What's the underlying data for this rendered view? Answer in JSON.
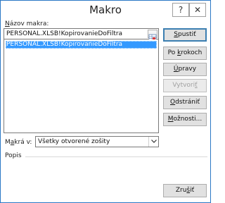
{
  "window": {
    "title": "Makro",
    "help_label": "?",
    "close_label": "✕"
  },
  "form": {
    "macro_name_label": "Názov makra:",
    "macro_name_access_key": "N",
    "macro_name_rest": "ázov makra:",
    "macro_name_value": "PERSONAL.XLSB!KopirovanieDoFiltra",
    "macro_list": [
      "PERSONAL.XLSB!KopirovanieDoFiltra"
    ],
    "macros_in_label": "Makrá v:",
    "macros_in_access_key": "a",
    "macros_in_prefix": "M",
    "macros_in_rest": "krá v:",
    "macros_in_value": "Všetky otvorené zošity",
    "description_label": "Popis"
  },
  "buttons": {
    "run": {
      "pre": "",
      "key": "S",
      "post": "pustiť"
    },
    "step_into": {
      "pre": "Po ",
      "key": "k",
      "post": "rokoch"
    },
    "edit": {
      "pre": "",
      "key": "Ú",
      "post": "pravy"
    },
    "create": {
      "pre": "Vytvori",
      "key": "ť",
      "post": ""
    },
    "delete": {
      "pre": "",
      "key": "O",
      "post": "dstrániť"
    },
    "options": {
      "pre": "",
      "key": "M",
      "post": "ožnosti..."
    },
    "cancel": {
      "pre": "Zru",
      "key": "š",
      "post": "iť"
    }
  },
  "colors": {
    "selection": "#3399ff",
    "window_border": "#2b78c5",
    "default_button_border": "#3c7fb1"
  }
}
